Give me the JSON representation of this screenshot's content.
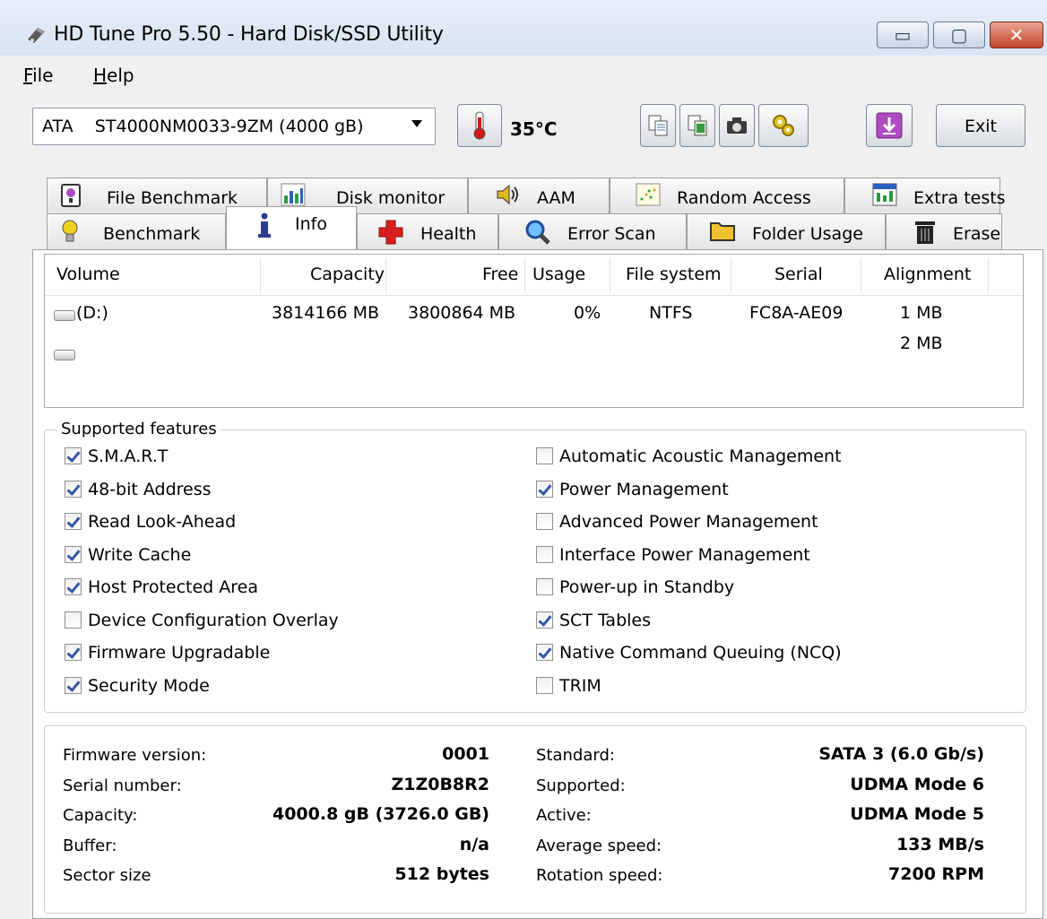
{
  "window": {
    "title": "HD Tune Pro 5.50 - Hard Disk/SSD Utility",
    "controls": {
      "minimize": "▭",
      "maximize": "▢",
      "close": "✕"
    }
  },
  "menu": [
    {
      "label": "File",
      "accel": "F",
      "rest": "ile"
    },
    {
      "label": "Help",
      "accel": "H",
      "rest": "elp"
    }
  ],
  "toolbar": {
    "drive": "ATA    ST4000NM0033-9ZM (4000 gB)",
    "temperature": "35°C",
    "exit_label": "Exit",
    "icons": [
      "thermometer-icon",
      "copy-text-icon",
      "copy-screenshot-icon",
      "camera-icon",
      "options-icon",
      "save-download-icon"
    ]
  },
  "tabs": {
    "row1": [
      "File Benchmark",
      "Disk monitor",
      "AAM",
      "Random Access",
      "Extra tests"
    ],
    "row2": [
      "Benchmark",
      "Info",
      "Health",
      "Error Scan",
      "Folder Usage",
      "Erase"
    ],
    "active": "Info"
  },
  "volumes": {
    "columns": [
      "Volume",
      "Capacity",
      "Free",
      "Usage",
      "File system",
      "Serial",
      "Alignment"
    ],
    "rows": [
      {
        "volume": "(D:)",
        "capacity": "3814166 MB",
        "free": "3800864 MB",
        "usage": "0%",
        "fs": "NTFS",
        "serial": "FC8A-AE09",
        "alignment": "1 MB"
      },
      {
        "volume": "",
        "capacity": "",
        "free": "",
        "usage": "",
        "fs": "",
        "serial": "",
        "alignment": "2 MB"
      }
    ]
  },
  "features": {
    "title": "Supported features",
    "left": [
      {
        "label": "S.M.A.R.T",
        "checked": true
      },
      {
        "label": "48-bit Address",
        "checked": true
      },
      {
        "label": "Read Look-Ahead",
        "checked": true
      },
      {
        "label": "Write Cache",
        "checked": true
      },
      {
        "label": "Host Protected Area",
        "checked": true
      },
      {
        "label": "Device Configuration Overlay",
        "checked": false
      },
      {
        "label": "Firmware Upgradable",
        "checked": true
      },
      {
        "label": "Security Mode",
        "checked": true
      }
    ],
    "right": [
      {
        "label": "Automatic Acoustic Management",
        "checked": false
      },
      {
        "label": "Power Management",
        "checked": true
      },
      {
        "label": "Advanced Power Management",
        "checked": false
      },
      {
        "label": "Interface Power Management",
        "checked": false
      },
      {
        "label": "Power-up in Standby",
        "checked": false
      },
      {
        "label": "SCT Tables",
        "checked": true
      },
      {
        "label": "Native Command Queuing (NCQ)",
        "checked": true
      },
      {
        "label": "TRIM",
        "checked": false
      }
    ]
  },
  "details": {
    "left": [
      {
        "label": "Firmware version:",
        "value": "0001"
      },
      {
        "label": "Serial number:",
        "value": "Z1Z0B8R2"
      },
      {
        "label": "Capacity:",
        "value": "4000.8 gB (3726.0 GB)"
      },
      {
        "label": "Buffer:",
        "value": "n/a"
      },
      {
        "label": "Sector size",
        "value": "512 bytes"
      }
    ],
    "right": [
      {
        "label": "Standard:",
        "value": "SATA 3 (6.0 Gb/s)"
      },
      {
        "label": "Supported:",
        "value": "UDMA Mode 6"
      },
      {
        "label": "Active:",
        "value": "UDMA Mode 5"
      },
      {
        "label": "Average speed:",
        "value": "133 MB/s"
      },
      {
        "label": "Rotation speed:",
        "value": "7200 RPM"
      }
    ]
  }
}
